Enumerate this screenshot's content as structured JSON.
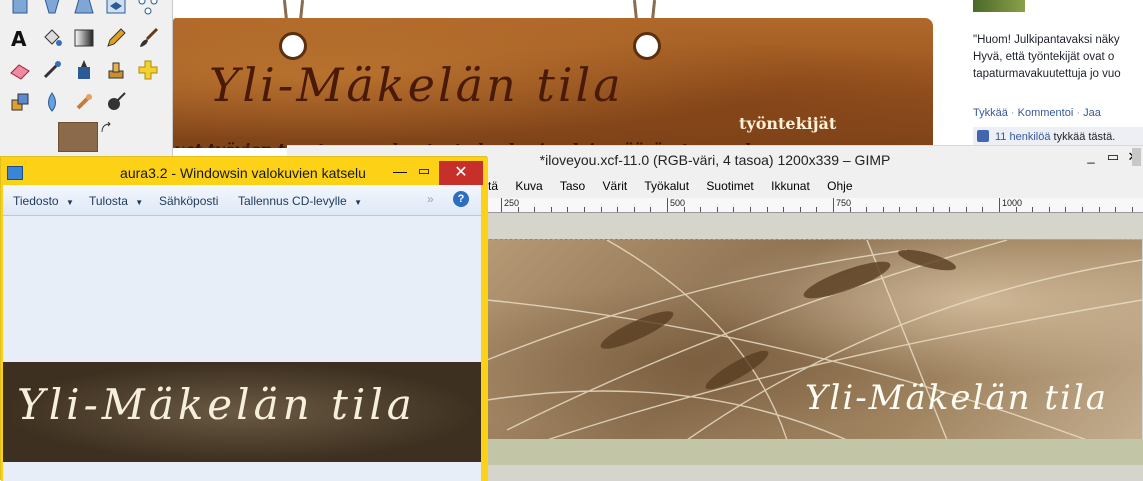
{
  "sign": {
    "script": "Yli-Mäkelän tila",
    "suffix": "työntekijät",
    "line2": "vat työvien tapaturmavakuutusta koskevien lainmääräysten mukaaa"
  },
  "facebook": {
    "post_lines": [
      "\"Huom! Julkipantavaksi näky",
      "Hyvä, että työntekijät ovat o",
      "tapaturmavakuutettuja jo vuo"
    ],
    "actions": [
      "Tykkää",
      "Kommentoi",
      "Jaa"
    ],
    "likes_link": "11 henkilöä",
    "likes_rest": "tykkää tästä."
  },
  "gimp": {
    "title": "*iloveyou.xcf-11.0 (RGB-väri, 4 tasoa) 1200x339 – GIMP",
    "menu": [
      "ytä",
      "Kuva",
      "Taso",
      "Värit",
      "Työkalut",
      "Suotimet",
      "Ikkunat",
      "Ohje"
    ],
    "ruler_labels": [
      "250",
      "500",
      "750",
      "1000"
    ],
    "image_script": "Yli-Mäkelän tila"
  },
  "photo_viewer": {
    "title": "aura3.2 - Windowsin valokuvien katselu",
    "toolbar": [
      "Tiedosto",
      "Tulosta",
      "Sähköposti",
      "Tallennus CD-levylle"
    ],
    "image_script": "Yli-Mäkelän tila"
  },
  "colors": {
    "photo_frame": "#fcd116",
    "close_red": "#c7302a",
    "fb_link": "#365899"
  }
}
